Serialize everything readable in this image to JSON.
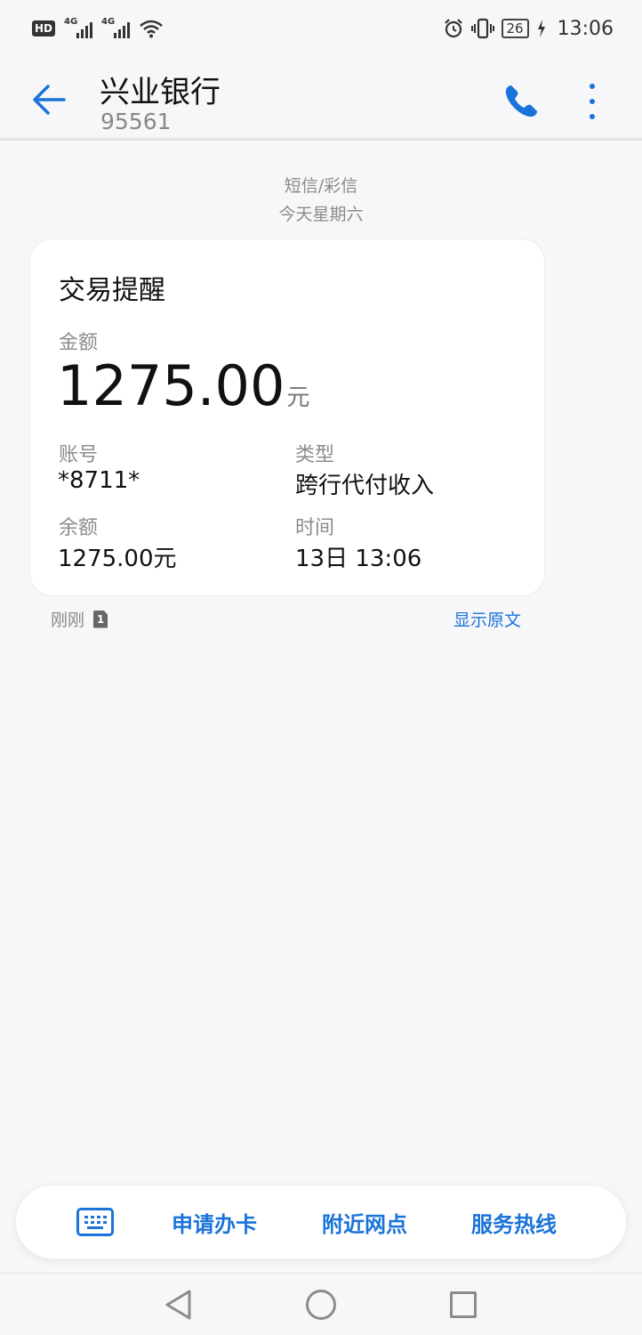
{
  "status_bar": {
    "hd_label": "HD",
    "sim1_label": "4G",
    "sim2_label": "4G",
    "battery_level": "26",
    "time": "13:06",
    "icons": [
      "wifi-icon",
      "alarm-icon",
      "vibrate-icon",
      "charging-icon"
    ]
  },
  "header": {
    "contact_name": "兴业银行",
    "contact_number": "95561",
    "icons": [
      "back-arrow-icon",
      "phone-icon",
      "more-vertical-icon"
    ]
  },
  "thread": {
    "message_type": "短信/彩信",
    "date_label": "今天星期六"
  },
  "card": {
    "title": "交易提醒",
    "amount_label": "金额",
    "amount_value": "1275.00",
    "amount_unit": "元",
    "account_label": "账号",
    "account_value": "*8711*",
    "type_label": "类型",
    "type_value": "跨行代付收入",
    "balance_label": "余额",
    "balance_value": "1275.00元",
    "time_label": "时间",
    "time_value": "13日 13:06"
  },
  "message_footer": {
    "sent_time": "刚刚",
    "sim_number": "1",
    "show_original": "显示原文"
  },
  "menu": {
    "items": [
      "申请办卡",
      "附近网点",
      "服务热线"
    ]
  },
  "colors": {
    "accent": "#1a73d9",
    "background": "#f7f7fa",
    "card": "#ffffff",
    "secondary_text": "#8a8a8a"
  }
}
